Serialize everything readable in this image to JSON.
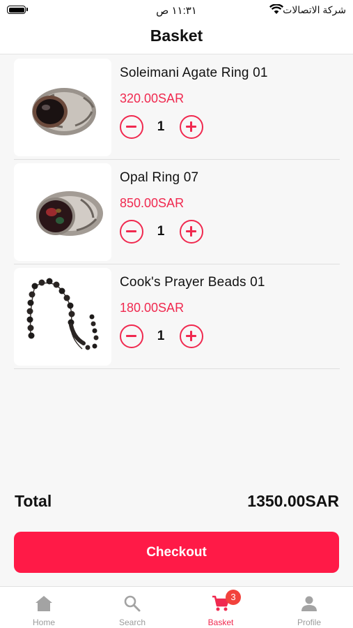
{
  "status_bar": {
    "time": "١١:٣١ ص",
    "carrier": "شركة الاتصالات"
  },
  "header": {
    "title": "Basket"
  },
  "items": [
    {
      "name": "Soleimani Agate Ring 01",
      "price": "320.00SAR",
      "quantity": "1",
      "image_icon": "agate-ring"
    },
    {
      "name": "Opal Ring 07",
      "price": "850.00SAR",
      "quantity": "1",
      "image_icon": "opal-ring"
    },
    {
      "name": "Cook's Prayer Beads 01",
      "price": "180.00SAR",
      "quantity": "1",
      "image_icon": "prayer-beads"
    }
  ],
  "summary": {
    "total_label": "Total",
    "total_value": "1350.00SAR"
  },
  "checkout_label": "Checkout",
  "tabbar": {
    "tabs": [
      {
        "label": "Home",
        "icon": "home-icon"
      },
      {
        "label": "Search",
        "icon": "search-icon"
      },
      {
        "label": "Basket",
        "icon": "cart-icon",
        "badge": "3",
        "active": true
      },
      {
        "label": "Profile",
        "icon": "person-icon"
      }
    ]
  },
  "colors": {
    "accent": "#f0294f",
    "checkout": "#ff1a47",
    "badge": "#f2423c",
    "inactive": "#9b9b9b"
  }
}
